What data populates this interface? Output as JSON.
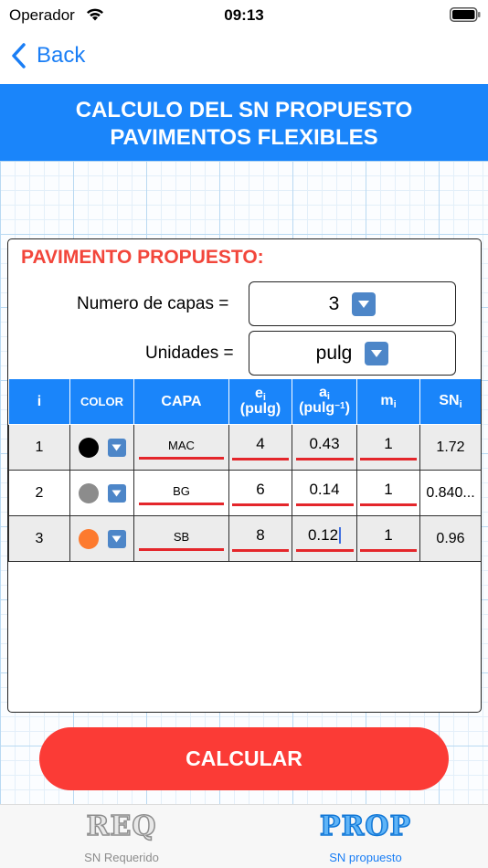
{
  "status": {
    "carrier": "Operador",
    "time": "09:13"
  },
  "nav": {
    "back_label": "Back"
  },
  "header": {
    "line1": "CALCULO DEL SN PROPUESTO",
    "line2": "PAVIMENTOS FLEXIBLES"
  },
  "form": {
    "title": "PAVIMENTO PROPUESTO:",
    "layers_label": "Numero de capas =",
    "layers_value": "3",
    "units_label": "Unidades =",
    "units_value": "pulg"
  },
  "table": {
    "headers": {
      "i": "i",
      "color": "COLOR",
      "capa": "CAPA",
      "e": "e",
      "e_sub": "i",
      "e_unit": "(pulg)",
      "a": "a",
      "a_sub": "i",
      "a_unit": "(pulg",
      "a_exp": "−1",
      "a_close": ")",
      "m": "m",
      "m_sub": "i",
      "sn": "SN",
      "sn_sub": "i"
    },
    "rows": [
      {
        "i": "1",
        "color": "#000000",
        "capa": "MAC",
        "e": "4",
        "a": "0.43",
        "m": "1",
        "sn": "1.72"
      },
      {
        "i": "2",
        "color": "#8c8c8c",
        "capa": "BG",
        "e": "6",
        "a": "0.14",
        "m": "1",
        "sn": "0.840..."
      },
      {
        "i": "3",
        "color": "#fd7a2e",
        "capa": "SB",
        "e": "8",
        "a": "0.12",
        "m": "1",
        "sn": "0.96"
      }
    ]
  },
  "actions": {
    "calculate_label": "CALCULAR"
  },
  "tabs": [
    {
      "icon_text": "REQ",
      "label": "SN Requerido",
      "active": false
    },
    {
      "icon_text": "PROP",
      "label": "SN propuesto",
      "active": true
    }
  ],
  "colors": {
    "accent": "#1a85fa",
    "danger": "#fb3b36",
    "title_red": "#f2463b",
    "link": "#1a7ef5"
  },
  "icons": {
    "dropdown": "chevron-down-icon",
    "back": "chevron-left-icon",
    "wifi": "wifi-icon",
    "battery": "battery-icon"
  }
}
